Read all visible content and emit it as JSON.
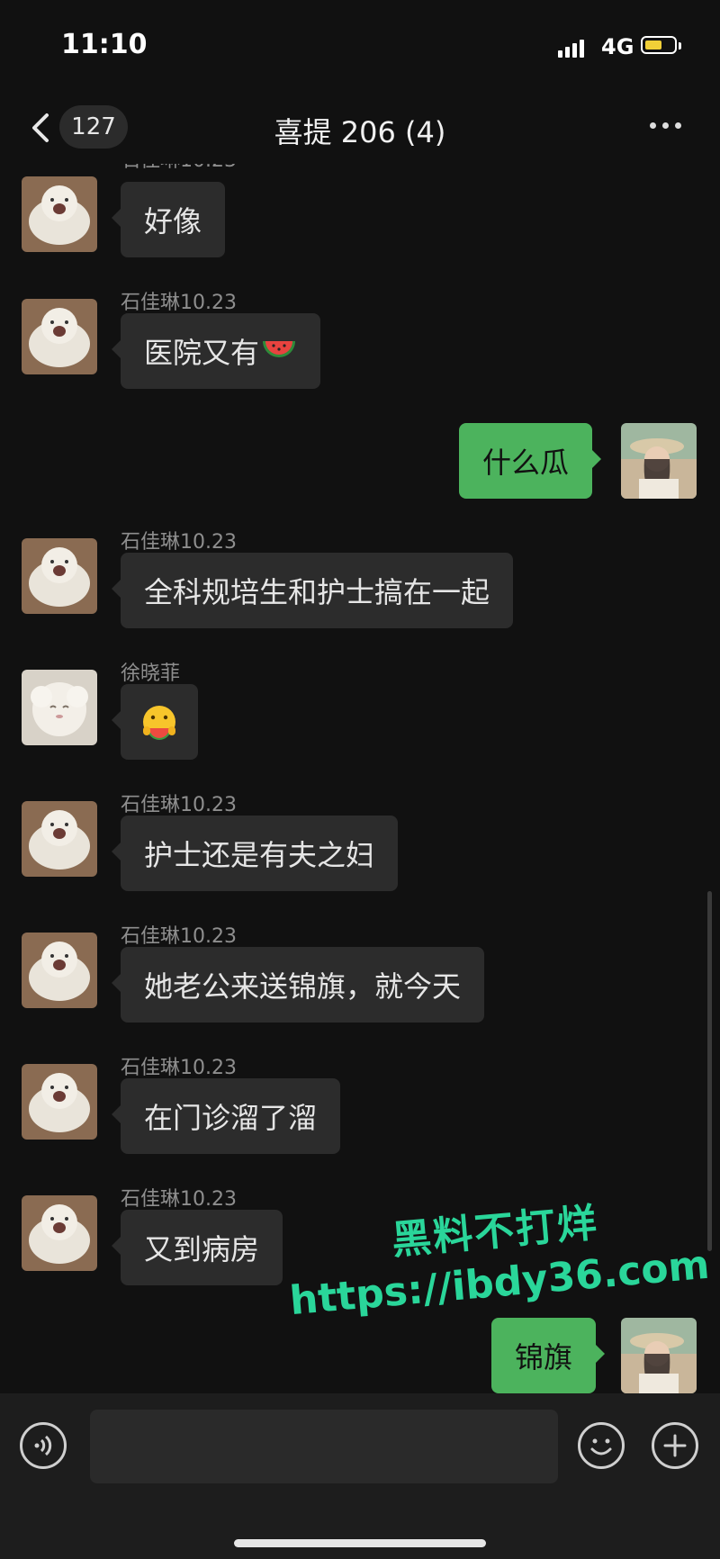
{
  "status_bar": {
    "time": "11:10",
    "network": "4G",
    "battery_level": 0.6,
    "battery_color": "#f1cf38"
  },
  "nav": {
    "back_badge": "127",
    "title": "喜提 206 (4)"
  },
  "messages": [
    {
      "direction": "in",
      "sender": "石佳琳10.23",
      "text": "好像",
      "avatar": "cat-avatar"
    },
    {
      "direction": "in",
      "sender": "石佳琳10.23",
      "text": "医院又有",
      "emoji": "watermelon-emoji",
      "avatar": "cat-avatar"
    },
    {
      "direction": "out",
      "text": "什么瓜",
      "avatar": "girl-photo-avatar"
    },
    {
      "direction": "in",
      "sender": "石佳琳10.23",
      "text": "全科规培生和护士搞在一起",
      "avatar": "cat-avatar"
    },
    {
      "direction": "in",
      "sender": "徐晓菲",
      "emoji": "eating-melon-emoji",
      "avatar": "sheep-avatar"
    },
    {
      "direction": "in",
      "sender": "石佳琳10.23",
      "text": "护士还是有夫之妇",
      "avatar": "cat-avatar"
    },
    {
      "direction": "in",
      "sender": "石佳琳10.23",
      "text": "她老公来送锦旗，就今天",
      "avatar": "cat-avatar"
    },
    {
      "direction": "in",
      "sender": "石佳琳10.23",
      "text": "在门诊溜了溜",
      "avatar": "cat-avatar"
    },
    {
      "direction": "in",
      "sender": "石佳琳10.23",
      "text": "又到病房",
      "avatar": "cat-avatar"
    },
    {
      "direction": "out",
      "text": "锦旗",
      "avatar": "girl-photo-avatar"
    }
  ],
  "watermark": {
    "line1": "黑料不打烊",
    "line2": "https://ibdy36.com"
  },
  "colors": {
    "outgoing_bubble": "#4cb35d",
    "incoming_bubble": "#2c2c2c",
    "background": "#111111",
    "watermark": "#2ad69a"
  }
}
